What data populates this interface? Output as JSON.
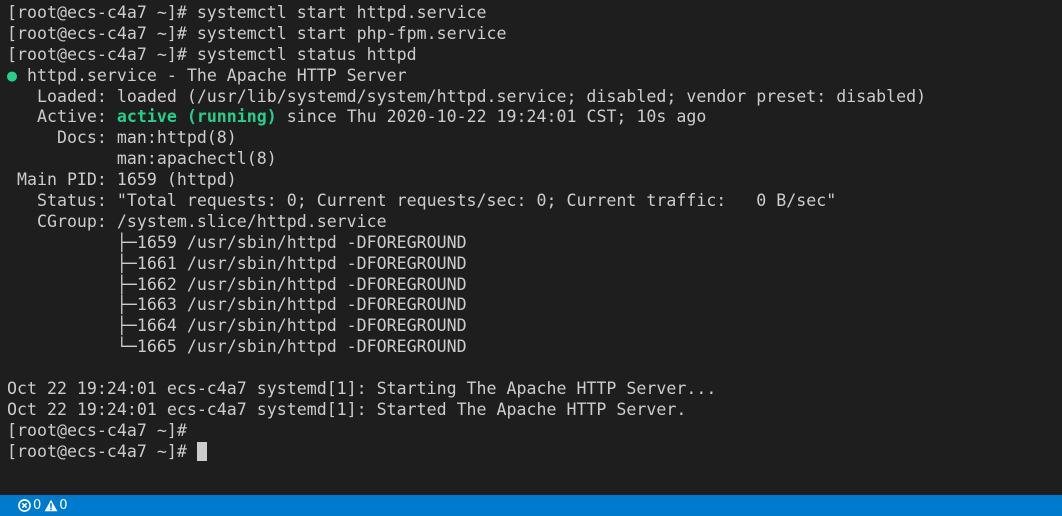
{
  "terminal": {
    "lines": [
      [
        {
          "text": "[root@ecs-c4a7 ~]# systemctl start httpd.service"
        }
      ],
      [
        {
          "text": "[root@ecs-c4a7 ~]# systemctl start php-fpm.service"
        }
      ],
      [
        {
          "text": "[root@ecs-c4a7 ~]# systemctl status httpd"
        }
      ],
      [
        {
          "text": "●",
          "style": "green"
        },
        {
          "text": " httpd.service - The Apache HTTP Server"
        }
      ],
      [
        {
          "text": "   Loaded: loaded (/usr/lib/systemd/system/httpd.service; disabled; vendor preset: disabled)"
        }
      ],
      [
        {
          "text": "   Active: "
        },
        {
          "text": "active (running)",
          "style": "green-bold"
        },
        {
          "text": " since Thu 2020-10-22 19:24:01 CST; 10s ago"
        }
      ],
      [
        {
          "text": "     Docs: man:httpd(8)"
        }
      ],
      [
        {
          "text": "           man:apachectl(8)"
        }
      ],
      [
        {
          "text": " Main PID: 1659 (httpd)"
        }
      ],
      [
        {
          "text": "   Status: \"Total requests: 0; Current requests/sec: 0; Current traffic:   0 B/sec\""
        }
      ],
      [
        {
          "text": "   CGroup: /system.slice/httpd.service"
        }
      ],
      [
        {
          "text": "           ├─1659 /usr/sbin/httpd -DFOREGROUND"
        }
      ],
      [
        {
          "text": "           ├─1661 /usr/sbin/httpd -DFOREGROUND"
        }
      ],
      [
        {
          "text": "           ├─1662 /usr/sbin/httpd -DFOREGROUND"
        }
      ],
      [
        {
          "text": "           ├─1663 /usr/sbin/httpd -DFOREGROUND"
        }
      ],
      [
        {
          "text": "           ├─1664 /usr/sbin/httpd -DFOREGROUND"
        }
      ],
      [
        {
          "text": "           └─1665 /usr/sbin/httpd -DFOREGROUND"
        }
      ],
      [
        {
          "text": ""
        }
      ],
      [
        {
          "text": "Oct 22 19:24:01 ecs-c4a7 systemd[1]: Starting The Apache HTTP Server..."
        }
      ],
      [
        {
          "text": "Oct 22 19:24:01 ecs-c4a7 systemd[1]: Started The Apache HTTP Server."
        }
      ],
      [
        {
          "text": "[root@ecs-c4a7 ~]#"
        }
      ],
      [
        {
          "text": "[root@ecs-c4a7 ~]# "
        },
        {
          "cursor": true
        }
      ]
    ],
    "colors": {
      "background": "#1e1e1e",
      "foreground": "#cccccc",
      "green": "#23d18b"
    }
  },
  "status_bar": {
    "background": "#007acc",
    "error_icon": "error-icon",
    "error_count": "0",
    "warning_icon": "warning-icon",
    "warning_count": "0"
  }
}
